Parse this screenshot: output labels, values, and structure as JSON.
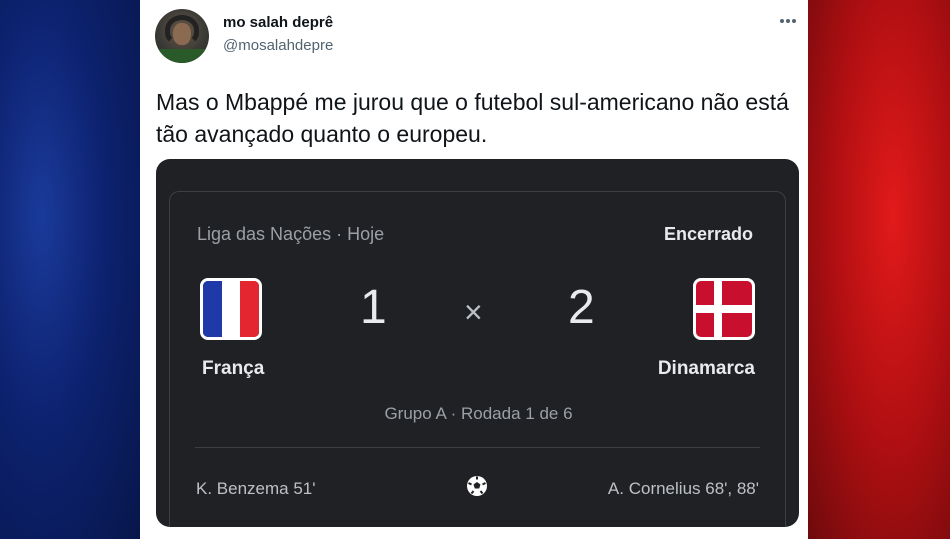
{
  "tweet": {
    "display_name": "mo salah deprê",
    "handle": "@mosalahdepre",
    "more_icon": "more-dots-icon",
    "text": "Mas o Mbappé me jurou que o futebol sul-americano não está tão avançado quanto o europeu."
  },
  "match": {
    "competition": "Liga das Nações · Hoje",
    "status": "Encerrado",
    "home": {
      "name": "França",
      "score": "1",
      "flag": "france-flag-icon",
      "scorer": "K. Benzema 51'"
    },
    "away": {
      "name": "Dinamarca",
      "score": "2",
      "flag": "denmark-flag-icon",
      "scorer": "A. Cornelius 68', 88'"
    },
    "separator": "×",
    "round": "Grupo A · Rodada 1 de 6",
    "goal_icon": "soccer-ball-icon"
  },
  "colors": {
    "left_bg": "#0d2270",
    "right_bg": "#b00f12",
    "card_bg": "#202124",
    "france_blue": "#1f3aa8",
    "france_red": "#e3262f",
    "denmark_red": "#c8102e"
  }
}
